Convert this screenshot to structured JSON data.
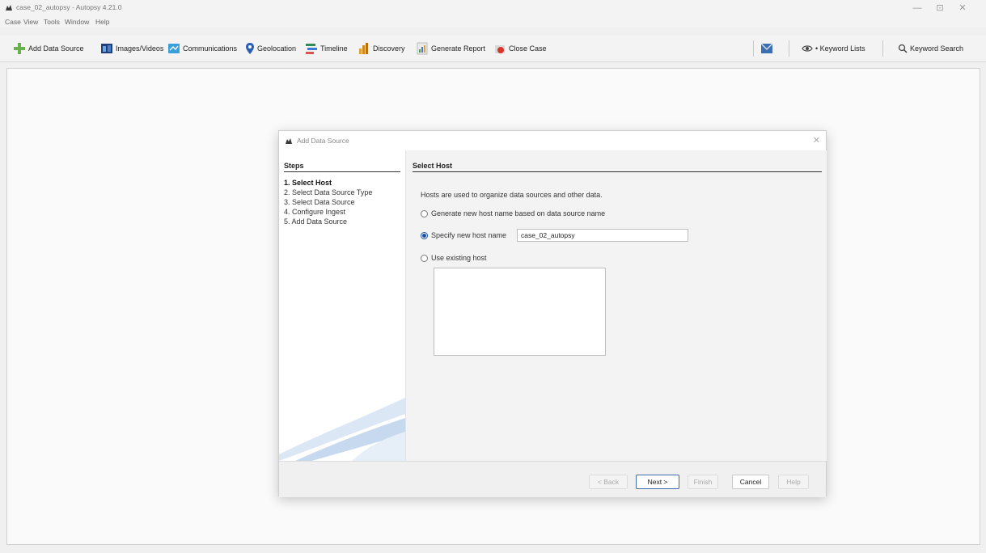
{
  "window": {
    "title": "case_02_autopsy - Autopsy 4.21.0",
    "minimize": "—",
    "maximize": "⊡",
    "close": "✕"
  },
  "menu": [
    "Case",
    "View",
    "Tools",
    "Window",
    "Help"
  ],
  "toolbar": {
    "add_data_source": "Add Data Source",
    "images_videos": "Images/Videos",
    "communications": "Communications",
    "geolocation": "Geolocation",
    "timeline": "Timeline",
    "discovery": "Discovery",
    "generate_report": "Generate Report",
    "close_case": "Close Case",
    "keyword_lists": "• Keyword Lists",
    "keyword_search": "Keyword Search"
  },
  "dialog": {
    "title": "Add Data Source",
    "steps_header": "Steps",
    "steps": [
      "1.  Select Host",
      "2.  Select Data Source Type",
      "3.  Select Data Source",
      "4.  Configure Ingest",
      "5.  Add Data Source"
    ],
    "content_header": "Select Host",
    "intro": "Hosts are used to organize data sources and other data.",
    "options": {
      "generate": "Generate new host name based on data source name",
      "specify": "Specify new host name",
      "existing": "Use existing host"
    },
    "selected_option": "specify",
    "host_name_value": "case_02_autopsy",
    "buttons": {
      "back": "< Back",
      "next": "Next >",
      "finish": "Finish",
      "cancel": "Cancel",
      "help": "Help"
    }
  },
  "colors": {
    "accent": "#1a4fa3",
    "background": "#f0f0f0"
  }
}
